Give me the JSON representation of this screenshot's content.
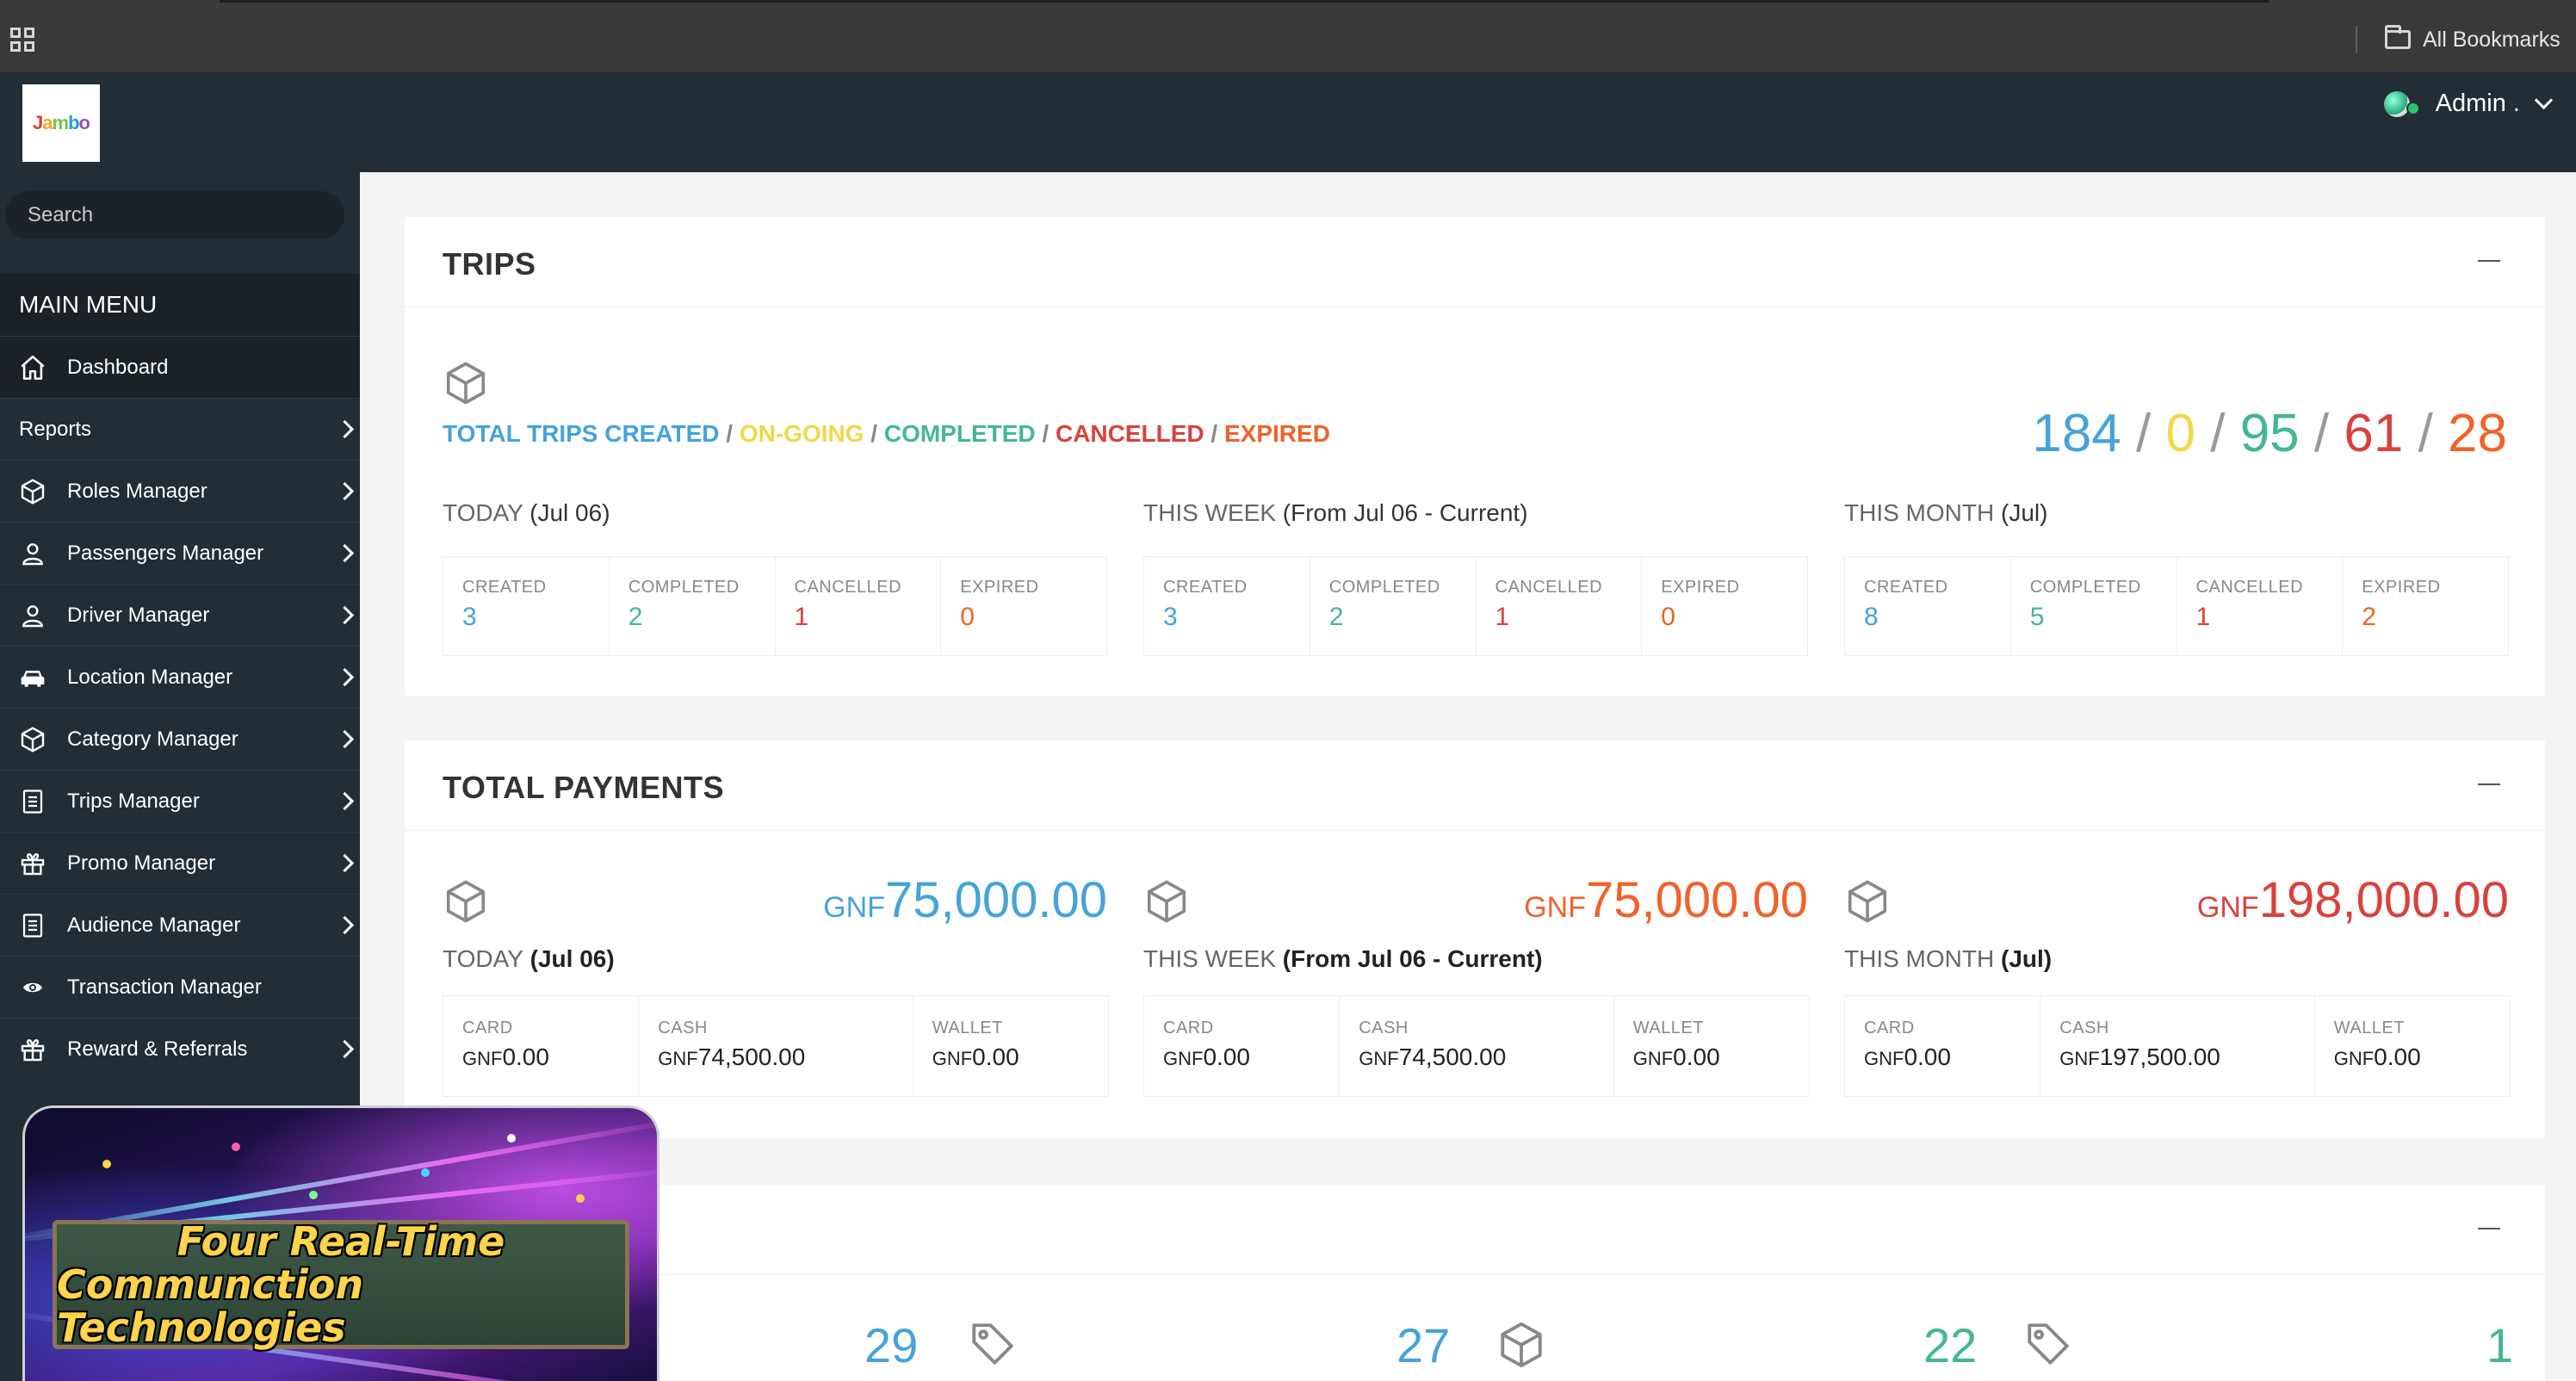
{
  "browser": {
    "bookmarks_label": "All Bookmarks"
  },
  "header": {
    "logo_text": "Jambo",
    "user": "Admin ."
  },
  "sidebar": {
    "search_placeholder": "Search",
    "main_menu": "MAIN MENU",
    "items": [
      {
        "label": "Dashboard",
        "icon": "home-icon",
        "arrow": false
      },
      {
        "label": "Reports",
        "icon": "",
        "arrow": true
      },
      {
        "label": "Roles Manager",
        "icon": "cube-icon",
        "arrow": true
      },
      {
        "label": "Passengers Manager",
        "icon": "user-icon",
        "arrow": true
      },
      {
        "label": "Driver Manager",
        "icon": "user-icon",
        "arrow": true
      },
      {
        "label": "Location Manager",
        "icon": "car-icon",
        "arrow": true
      },
      {
        "label": "Category Manager",
        "icon": "cube-icon",
        "arrow": true
      },
      {
        "label": "Trips Manager",
        "icon": "document-icon",
        "arrow": true
      },
      {
        "label": "Promo Manager",
        "icon": "gift-icon",
        "arrow": true
      },
      {
        "label": "Audience Manager",
        "icon": "document-icon",
        "arrow": true
      },
      {
        "label": "Transaction Manager",
        "icon": "eye-icon",
        "arrow": false
      },
      {
        "label": "Reward & Referrals",
        "icon": "gift-icon",
        "arrow": true
      }
    ]
  },
  "trips": {
    "title": "TRIPS",
    "legend": {
      "created": "TOTAL TRIPS CREATED",
      "ongoing": "ON-GOING",
      "completed": "COMPLETED",
      "cancelled": "CANCELLED",
      "expired": "EXPIRED",
      "sep": " / "
    },
    "totals": {
      "created": "184",
      "ongoing": "0",
      "completed": "95",
      "cancelled": "61",
      "expired": "28",
      "sep": "/"
    },
    "periods": [
      {
        "label": "TODAY",
        "range": "(Jul 06)",
        "stats": [
          {
            "label": "CREATED",
            "value": "3"
          },
          {
            "label": "COMPLETED",
            "value": "2"
          },
          {
            "label": "CANCELLED",
            "value": "1"
          },
          {
            "label": "EXPIRED",
            "value": "0"
          }
        ]
      },
      {
        "label": "THIS WEEK",
        "range": "(From Jul 06 - Current)",
        "stats": [
          {
            "label": "CREATED",
            "value": "3"
          },
          {
            "label": "COMPLETED",
            "value": "2"
          },
          {
            "label": "CANCELLED",
            "value": "1"
          },
          {
            "label": "EXPIRED",
            "value": "0"
          }
        ]
      },
      {
        "label": "THIS MONTH",
        "range": "(Jul)",
        "stats": [
          {
            "label": "CREATED",
            "value": "8"
          },
          {
            "label": "COMPLETED",
            "value": "5"
          },
          {
            "label": "CANCELLED",
            "value": "1"
          },
          {
            "label": "EXPIRED",
            "value": "2"
          }
        ]
      }
    ]
  },
  "payments": {
    "title": "TOTAL PAYMENTS",
    "currency": "GNF",
    "periods": [
      {
        "label": "TODAY",
        "range": "(Jul 06)",
        "amount": "75,000.00",
        "card_label": "CARD",
        "card": "0.00",
        "cash_label": "CASH",
        "cash": "74,500.00",
        "wallet_label": "WALLET",
        "wallet": "0.00"
      },
      {
        "label": "THIS WEEK",
        "range": "(From Jul 06 - Current)",
        "amount": "75,000.00",
        "card_label": "CARD",
        "card": "0.00",
        "cash_label": "CASH",
        "cash": "74,500.00",
        "wallet_label": "WALLET",
        "wallet": "0.00"
      },
      {
        "label": "THIS MONTH",
        "range": "(Jul)",
        "amount": "198,000.00",
        "card_label": "CARD",
        "card": "0.00",
        "cash_label": "CASH",
        "cash": "197,500.00",
        "wallet_label": "WALLET",
        "wallet": "0.00"
      }
    ]
  },
  "third_panel": {
    "values": [
      "29",
      "27",
      "22",
      "1"
    ]
  },
  "video_overlay": {
    "line1": "Four Real-Time",
    "line2": "Communction Technologies"
  },
  "colors": {
    "blue": "#45a3d9",
    "yellow": "#f1d84a",
    "green": "#43b88f",
    "red": "#d9413c",
    "orange": "#f0622a",
    "sidebar": "#222d35"
  }
}
